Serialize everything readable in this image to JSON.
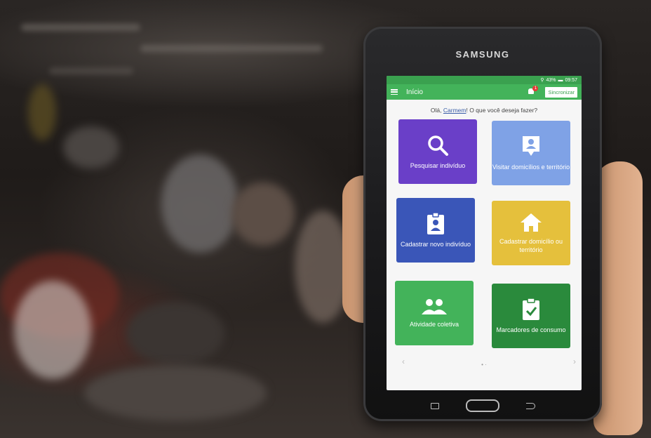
{
  "device": {
    "brand": "SAMSUNG"
  },
  "status": {
    "battery": "43%",
    "time": "09:57"
  },
  "appbar": {
    "title": "Início",
    "notification_count": "1",
    "sync_label": "Sincronizar"
  },
  "greeting": {
    "prefix": "Olá,",
    "name": "Carmem",
    "suffix": "! O que você deseja fazer?"
  },
  "tiles": [
    {
      "label": "Pesquisar indivíduo",
      "icon": "search-icon",
      "color": "#6a3fc8"
    },
    {
      "label": "Visitar domicílios e território",
      "icon": "person-pin-icon",
      "color": "#7fa2e6"
    },
    {
      "label": "Cadastrar novo indivíduo",
      "icon": "id-badge-icon",
      "color": "#3a56b8"
    },
    {
      "label": "Cadastrar domicílio ou território",
      "icon": "home-icon",
      "color": "#e5c03c"
    },
    {
      "label": "Atividade coletiva",
      "icon": "group-icon",
      "color": "#43b35a"
    },
    {
      "label": "Marcadores de consumo",
      "icon": "clipboard-check-icon",
      "color": "#2a8a3c"
    }
  ],
  "pager": {
    "dots": "• ·"
  },
  "colors": {
    "appbar": "#43b35a"
  }
}
